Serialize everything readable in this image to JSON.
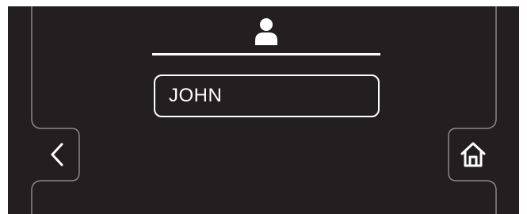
{
  "profile": {
    "icon": "user-icon",
    "name_value": "JOHN"
  },
  "navigation": {
    "back_icon": "chevron-left-icon",
    "home_icon": "home-icon"
  },
  "colors": {
    "background": "#231f20",
    "foreground": "#ffffff",
    "page": "#ffffff"
  }
}
